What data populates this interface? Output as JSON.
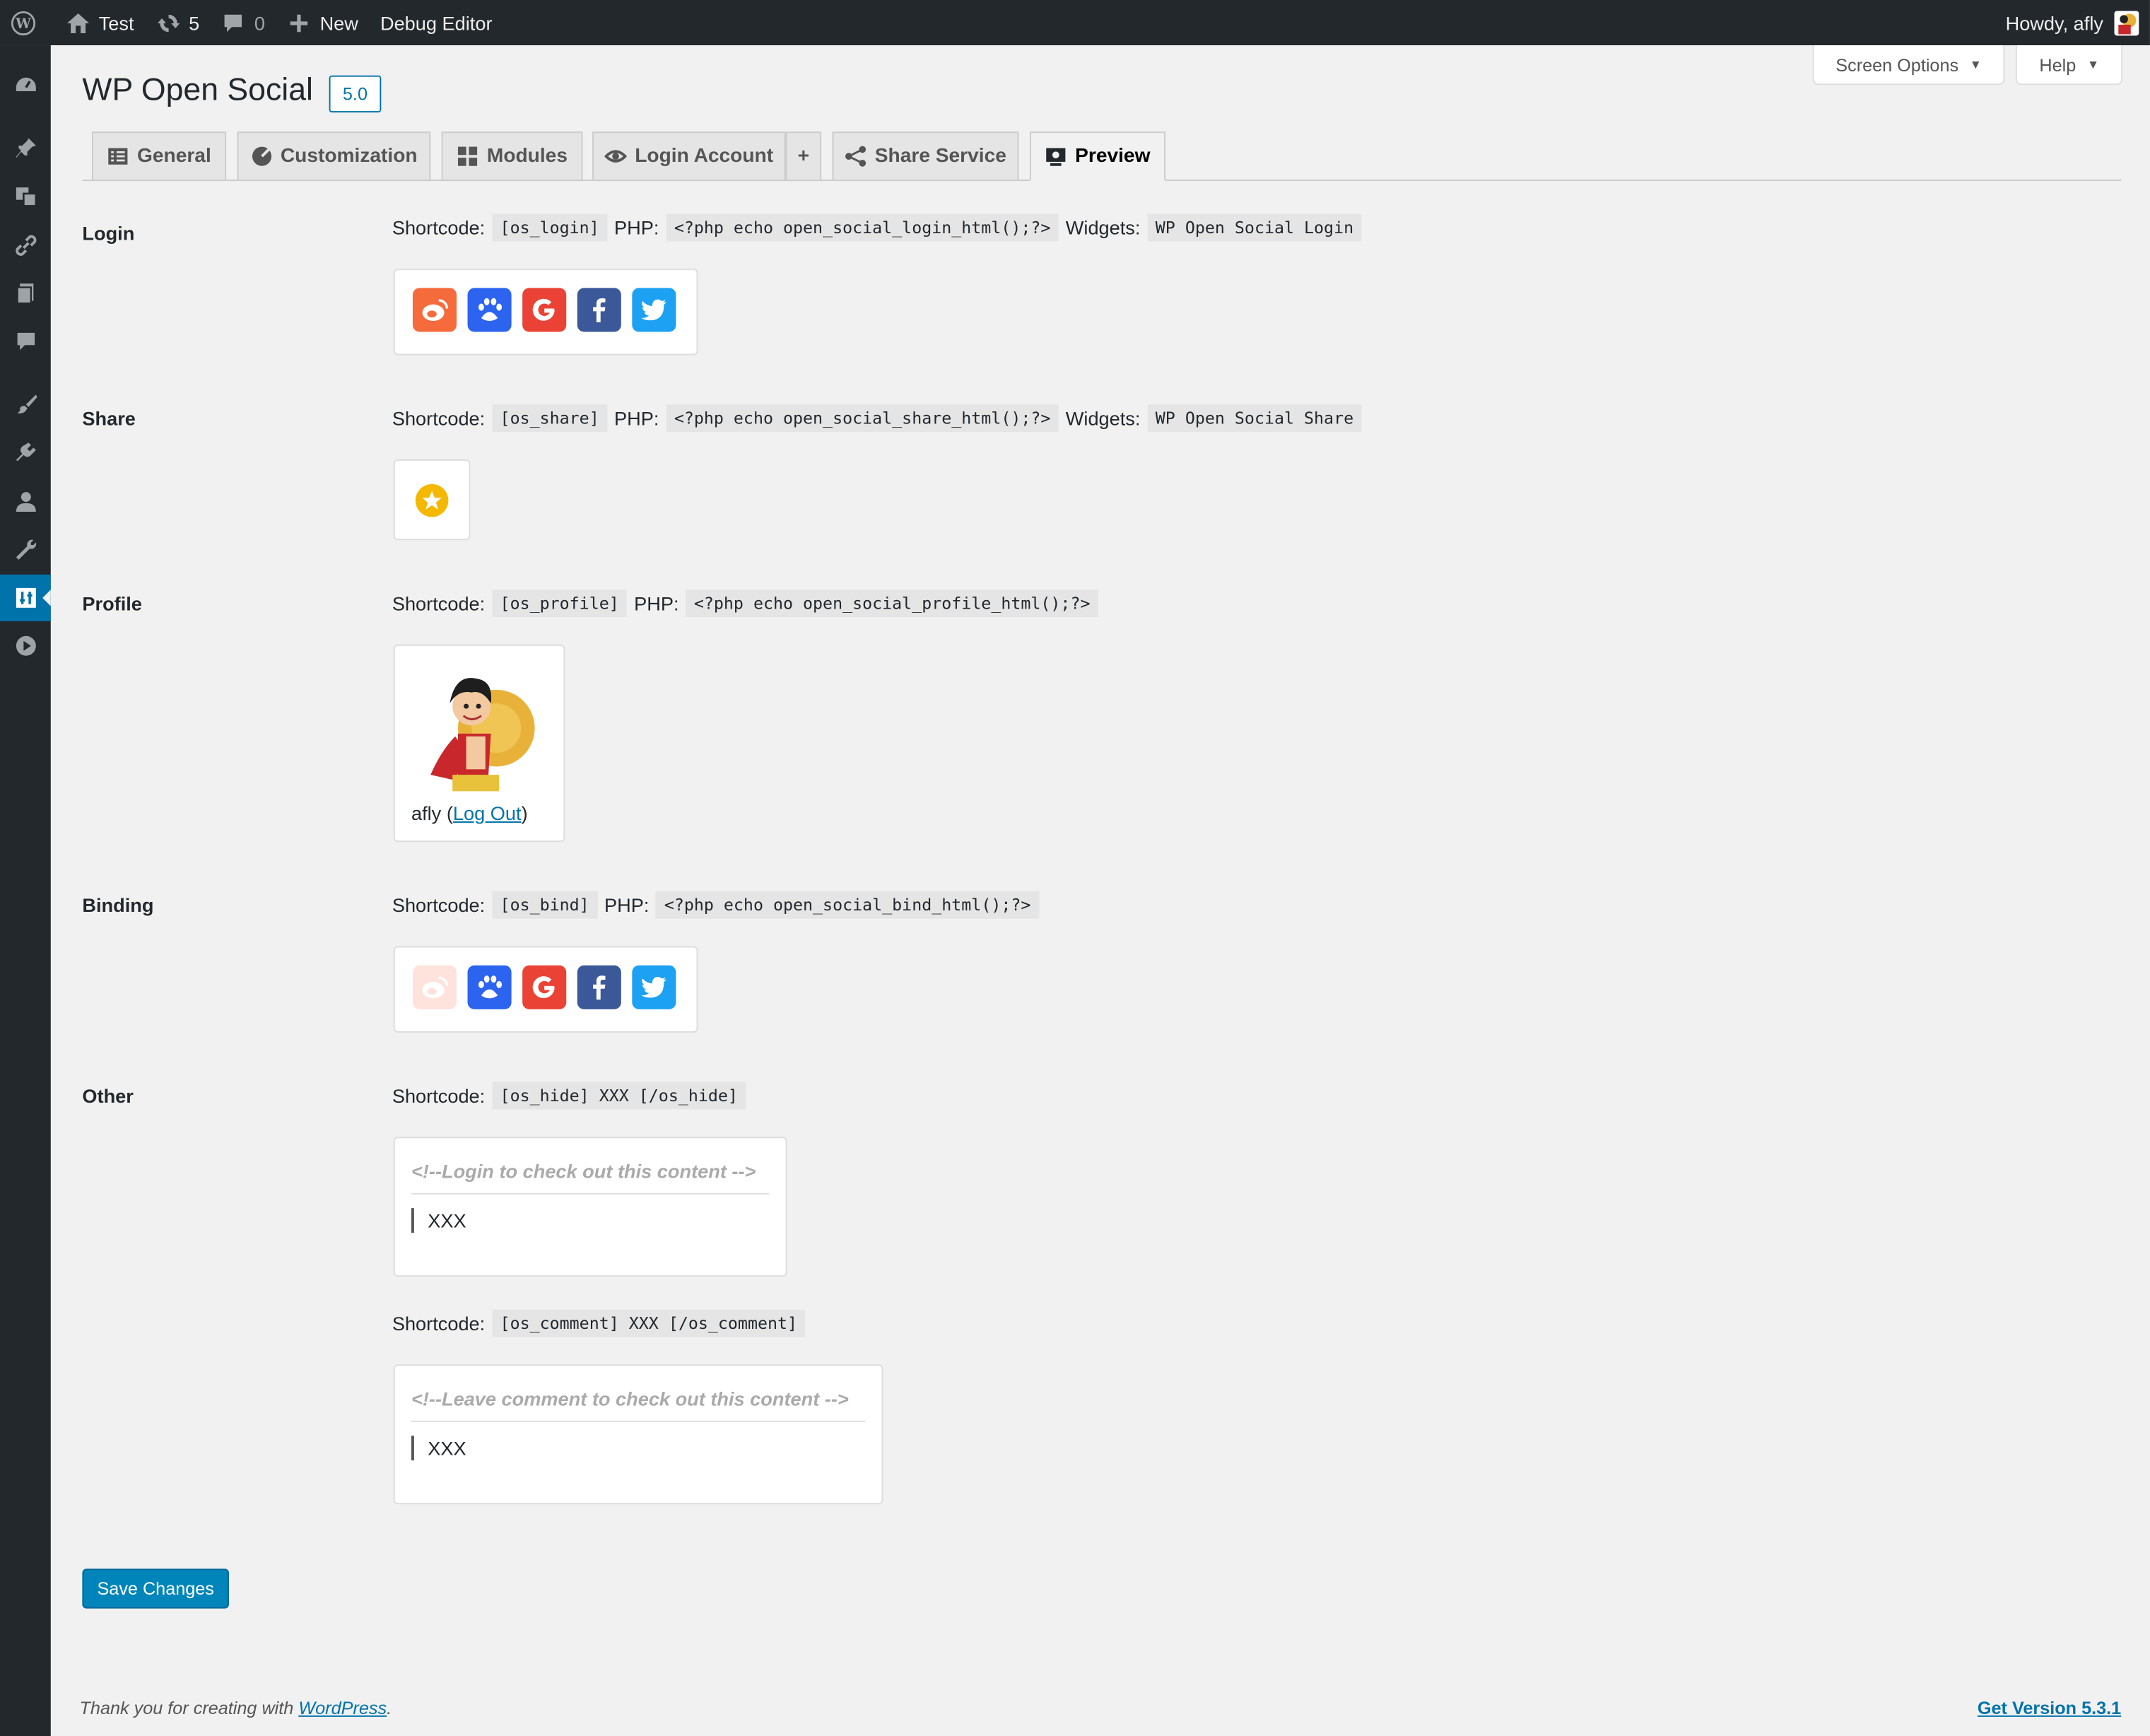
{
  "adminbar": {
    "site_name": "Test",
    "updates_count": "5",
    "comments_count": "0",
    "new_label": "New",
    "debug_label": "Debug Editor",
    "howdy": "Howdy, afly"
  },
  "screen_meta": {
    "screen_options": "Screen Options",
    "help": "Help"
  },
  "page": {
    "title": "WP Open Social",
    "version": "5.0"
  },
  "tabs": [
    {
      "label": "General",
      "icon": "form-icon"
    },
    {
      "label": "Customization",
      "icon": "palette-icon"
    },
    {
      "label": "Modules",
      "icon": "grid-icon"
    },
    {
      "label": "Login Account",
      "icon": "eye-icon"
    },
    {
      "label": "+",
      "icon": ""
    },
    {
      "label": "Share Service",
      "icon": "share-icon"
    },
    {
      "label": "Preview",
      "icon": "monitor-icon"
    }
  ],
  "sections": {
    "login": {
      "label": "Login",
      "shortcode_label": "Shortcode:",
      "shortcode": "[os_login]",
      "php_label": "PHP:",
      "php": "<?php echo open_social_login_html();?>",
      "widgets_label": "Widgets:",
      "widgets": "WP Open Social Login"
    },
    "share": {
      "label": "Share",
      "shortcode_label": "Shortcode:",
      "shortcode": "[os_share]",
      "php_label": "PHP:",
      "php": "<?php echo open_social_share_html();?>",
      "widgets_label": "Widgets:",
      "widgets": "WP Open Social Share"
    },
    "profile": {
      "label": "Profile",
      "shortcode_label": "Shortcode:",
      "shortcode": "[os_profile]",
      "php_label": "PHP:",
      "php": "<?php echo open_social_profile_html();?>",
      "username": "afly",
      "paren_open": "(",
      "logout": "Log Out",
      "paren_close": ")"
    },
    "binding": {
      "label": "Binding",
      "shortcode_label": "Shortcode:",
      "shortcode": "[os_bind]",
      "php_label": "PHP:",
      "php": "<?php echo open_social_bind_html();?>"
    },
    "other": {
      "label": "Other",
      "hide_shortcode_label": "Shortcode:",
      "hide_shortcode": "[os_hide] XXX [/os_hide]",
      "hide_title": "<!--Login to check out this content -->",
      "hide_content": "XXX",
      "comment_shortcode_label": "Shortcode:",
      "comment_shortcode": "[os_comment] XXX [/os_comment]",
      "comment_title": "<!--Leave comment to check out this content -->",
      "comment_content": "XXX"
    }
  },
  "social_icons": [
    "weibo-icon",
    "baidu-icon",
    "google-icon",
    "facebook-icon",
    "twitter-icon"
  ],
  "colors": {
    "weibo": "#f56b3c",
    "baidu": "#2c64f0",
    "google": "#ea4335",
    "facebook": "#3b5998",
    "twitter": "#1da1f2",
    "share_star": "#f5b800",
    "primary": "#0085ba"
  },
  "save_label": "Save Changes",
  "footer": {
    "thanks": "Thank you for creating with ",
    "wp_link": "WordPress",
    "period": ".",
    "version": "Get Version 5.3.1"
  }
}
